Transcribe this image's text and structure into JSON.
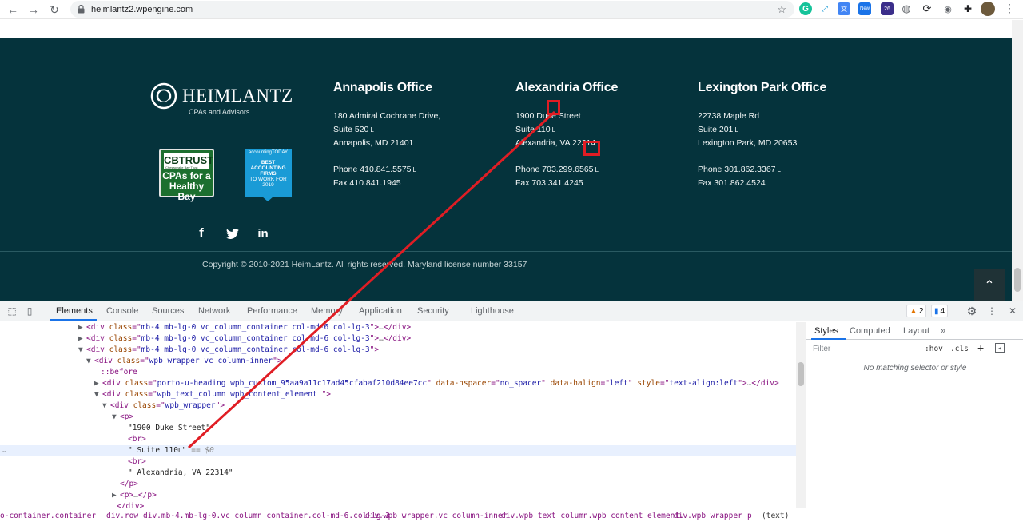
{
  "browser": {
    "url": "heimlantz2.wpengine.com",
    "nav": {
      "back": "←",
      "forward": "→",
      "reload": "↻"
    },
    "icons": [
      "star-icon",
      "grammarly-icon",
      "expand-icon",
      "translate-icon",
      "new-extension-icon",
      "extension-26-icon",
      "globe-icon",
      "sync-icon",
      "camera-icon",
      "puzzle-icon",
      "avatar",
      "menu-icon"
    ],
    "ext_badge_new": "New",
    "ext_badge_num": "26"
  },
  "site": {
    "logo": {
      "name": "HEIMLANTZ",
      "tagline": "CPAs and Advisors"
    },
    "badges": {
      "cbtrust_top": "CBTRUST",
      "cbtrust_sub": "Chesapeake Bay Trust",
      "cbtrust_bottom_1": "CPAs for a",
      "cbtrust_bottom_2": "Healthy Bay",
      "at_brand": "accountingTODAY",
      "at_line1": "BEST",
      "at_line2": "ACCOUNTING",
      "at_line3": "FIRMS",
      "at_line4": "TO WORK FOR",
      "at_year": "2019"
    },
    "offices": [
      {
        "title": "Annapolis Office",
        "address1": "180 Admiral Cochrane Drive,",
        "address2": "Suite 520",
        "address3": "Annapolis, MD 21401",
        "phone": "Phone 410.841.5575",
        "fax": "Fax 410.841.1945"
      },
      {
        "title": "Alexandria Office",
        "address1": "1900 Duke Street",
        "address2": "Suite 110",
        "address3": "Alexandria, VA 22314",
        "phone": "Phone 703.299.6565",
        "fax": "Fax 703.341.4245"
      },
      {
        "title": "Lexington Park Office",
        "address1": "22738 Maple Rd",
        "address2": "Suite 201",
        "address3": "Lexington Park, MD 20653",
        "phone": "Phone 301.862.3367",
        "fax": "Fax 301.862.4524"
      }
    ],
    "stray_char": "L",
    "social": {
      "facebook": "f",
      "twitter": "t",
      "linkedin": "in"
    },
    "copyright": "Copyright © 2010-2021 HeimLantz. All rights reserved. Maryland license number 33157",
    "back_to_top": "⌃"
  },
  "devtools": {
    "tabs": [
      "Elements",
      "Console",
      "Sources",
      "Network",
      "Performance",
      "Memory",
      "Application",
      "Security",
      "Lighthouse"
    ],
    "active_tab": "Elements",
    "warnings": "2",
    "messages": "4",
    "elements": {
      "line1_class": "mb-4 mb-lg-0 vc_column_container col-md-6 col-lg-3",
      "line2_class": "mb-4 mb-lg-0 vc_column_container col-md-6 col-lg-3",
      "line3_class": "mb-4 mb-lg-0 vc_column_container col-md-6 col-lg-3",
      "line4_class": "wpb_wrapper vc_column-inner",
      "before": "::before",
      "line6_class": "porto-u-heading  wpb_custom_95aa9a11c17ad45cfabaf210d84ee7cc",
      "line6_hspacer": "no_spacer",
      "line6_halign": "left",
      "line6_style": "text-align:left",
      "line7_class": "wpb_text_column wpb_content_element ",
      "line8_class": "wpb_wrapper",
      "text1": "\"1900 Duke Street\"",
      "text2": "\" Suite 110",
      "text2_char": "L",
      "text2_marker": "== $0",
      "text3": "\" Alexandria, VA 22314\"",
      "ellipsis": "…",
      "dots": "…"
    },
    "styles": {
      "tabs": [
        "Styles",
        "Computed",
        "Layout"
      ],
      "more": "»",
      "filter_placeholder": "Filter",
      "hov": ":hov",
      "cls": ".cls",
      "plus": "+",
      "empty": "No matching selector or style"
    },
    "breadcrumbs": [
      "o-container.container",
      "div.row",
      "div.mb-4.mb-lg-0.vc_column_container.col-md-6.col-lg-3",
      "div.wpb_wrapper.vc_column-inner",
      "div.wpb_text_column.wpb_content_element.",
      "div.wpb_wrapper",
      "p",
      "(text)"
    ]
  }
}
